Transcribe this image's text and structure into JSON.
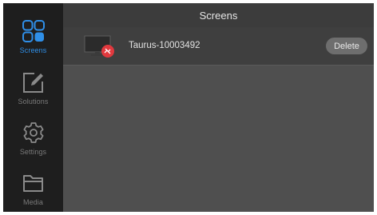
{
  "header": {
    "title": "Screens"
  },
  "sidebar": {
    "items": [
      {
        "label": "Screens",
        "icon": "grid-icon",
        "active": true
      },
      {
        "label": "Solutions",
        "icon": "edit-icon",
        "active": false
      },
      {
        "label": "Settings",
        "icon": "gear-icon",
        "active": false
      },
      {
        "label": "Media",
        "icon": "folder-icon",
        "active": false
      }
    ]
  },
  "screens": [
    {
      "name": "Taurus-10003492",
      "status_icon": "disconnected-icon",
      "delete_label": "Delete"
    }
  ],
  "colors": {
    "accent": "#2f8fe8",
    "sidebar_bg": "#1e1e1e",
    "content_bg": "#4f4f4f",
    "status_error": "#e0393e"
  }
}
